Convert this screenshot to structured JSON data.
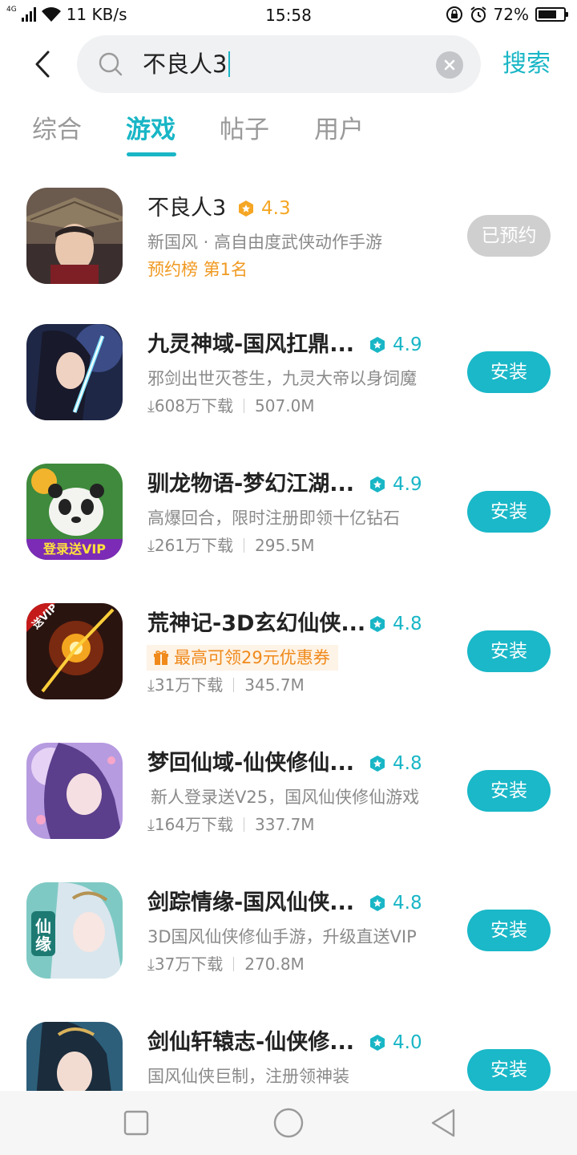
{
  "status_bar": {
    "network_type": "4G",
    "speed": "11 KB/s",
    "time": "15:58",
    "battery": "72%",
    "battery_level": 0.72
  },
  "search": {
    "query": "不良人3",
    "submit_label": "搜索"
  },
  "tabs": [
    {
      "label": "综合"
    },
    {
      "label": "游戏"
    },
    {
      "label": "帖子"
    },
    {
      "label": "用户"
    }
  ],
  "active_tab_index": 1,
  "colors": {
    "accent": "#19b6c6",
    "rating_gold": "#f5a623",
    "rating_teal": "#19b6c6",
    "orange_text": "#f09a22",
    "reserved_button": "#cfcfcf"
  },
  "results": [
    {
      "name": "不良人3",
      "rating": "4.3",
      "rating_icon": "gold-hexagon-star-icon",
      "description": "新国风 · 高自由度武侠动作手游",
      "rank": "预约榜 第1名",
      "button": "已预约",
      "button_state": "reserved"
    },
    {
      "name": "九灵神域-国风扛鼎...",
      "rating": "4.9",
      "rating_icon": "teal-hexagon-star-icon",
      "description": "邪剑出世灭苍生，九灵大帝以身饲魔",
      "downloads": "608万下载",
      "size": "507.0M",
      "button": "安装"
    },
    {
      "name": "驯龙物语-梦幻江湖...",
      "rating": "4.9",
      "rating_icon": "teal-hexagon-star-icon",
      "description": "高爆回合，限时注册即领十亿钻石",
      "downloads": "261万下载",
      "size": "295.5M",
      "button": "安装",
      "icon_badge": "登录送VIP"
    },
    {
      "name": "荒神记-3D玄幻仙侠...",
      "rating": "4.8",
      "rating_icon": "teal-hexagon-star-icon",
      "coupon": "最高可领29元优惠券",
      "downloads": "31万下载",
      "size": "345.7M",
      "button": "安装",
      "icon_badge": "送VIP"
    },
    {
      "name": "梦回仙域-仙侠修仙...",
      "rating": "4.8",
      "rating_icon": "teal-hexagon-star-icon",
      "description": "新人登录送V25，国风仙侠修仙游戏",
      "downloads": "164万下载",
      "size": "337.7M",
      "button": "安装"
    },
    {
      "name": "剑踪情缘-国风仙侠...",
      "rating": "4.8",
      "rating_icon": "teal-hexagon-star-icon",
      "description": "3D国风仙侠修仙手游，升级直送VIP",
      "downloads": "37万下载",
      "size": "270.8M",
      "button": "安装",
      "icon_badge": "仙缘"
    },
    {
      "name": "剑仙轩辕志-仙侠修...",
      "rating": "4.0",
      "rating_icon": "teal-hexagon-star-icon",
      "description": "国风仙侠巨制，注册领神装",
      "button": "安装"
    }
  ],
  "nav_bar": {
    "buttons": [
      "square-recent-icon",
      "circle-home-icon",
      "triangle-back-icon"
    ]
  }
}
